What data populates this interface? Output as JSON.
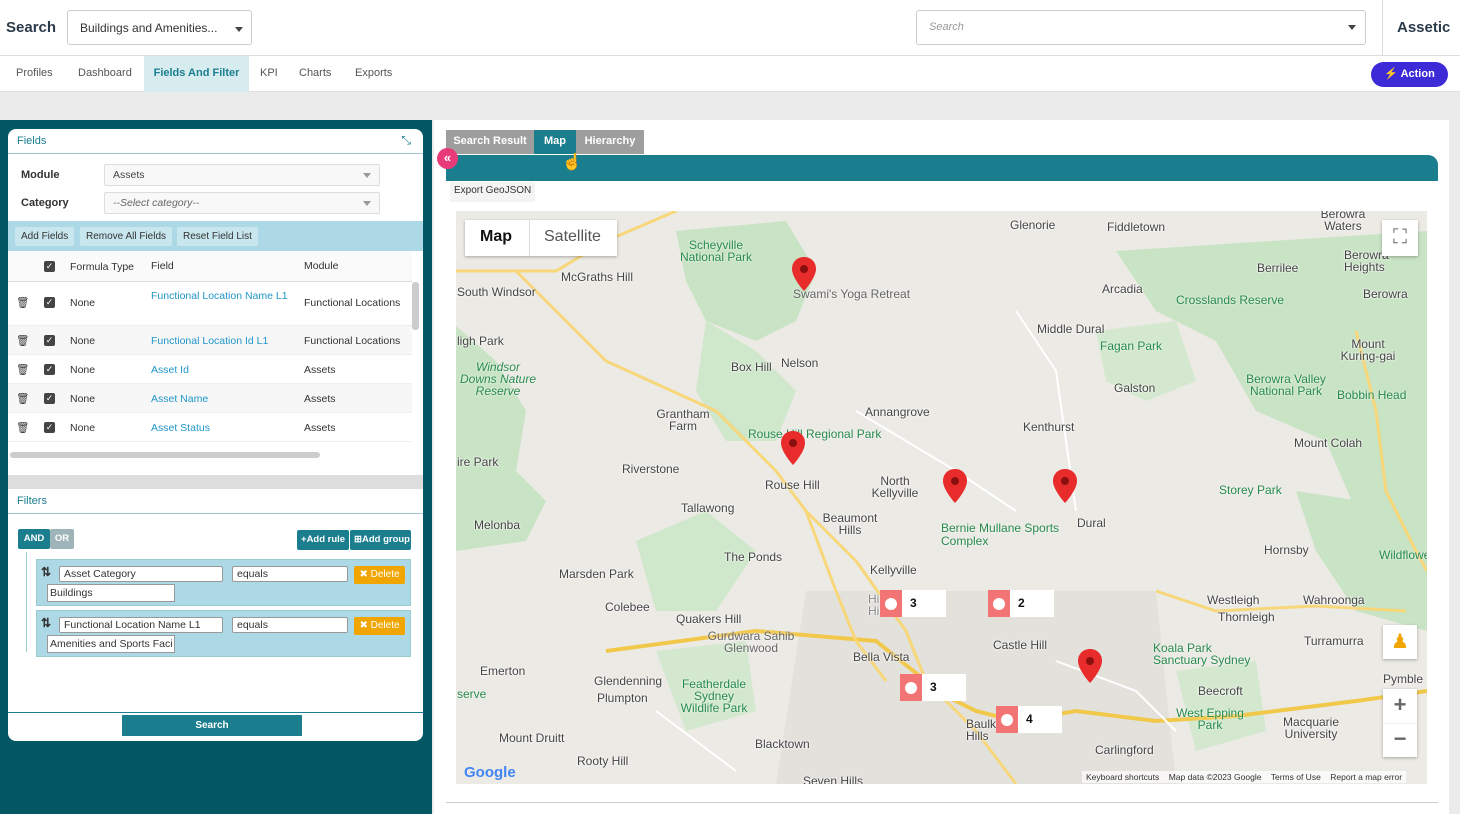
{
  "topbar": {
    "title": "Search",
    "profile_value": "Buildings and Amenities...",
    "search_placeholder": "Search",
    "brand": "Assetic"
  },
  "nav": {
    "tabs": [
      "Profiles",
      "Dashboard",
      "Fields And Filter",
      "KPI",
      "Charts",
      "Exports"
    ],
    "active": "Fields And Filter",
    "action_label": "Action"
  },
  "fields": {
    "title": "Fields",
    "module_label": "Module",
    "module_value": "Assets",
    "category_label": "Category",
    "category_value": "--Select category--",
    "buttons": [
      "Add Fields",
      "Remove All Fields",
      "Reset Field List"
    ],
    "columns": [
      "Formula Type",
      "Field",
      "Module"
    ],
    "rows": [
      {
        "formula": "None",
        "field": "Functional Location Name L1",
        "module": "Functional Locations"
      },
      {
        "formula": "None",
        "field": "Functional Location Id L1",
        "module": "Functional Locations"
      },
      {
        "formula": "None",
        "field": "Asset Id",
        "module": "Assets"
      },
      {
        "formula": "None",
        "field": "Asset Name",
        "module": "Assets"
      },
      {
        "formula": "None",
        "field": "Asset Status",
        "module": "Assets"
      }
    ]
  },
  "filters": {
    "title": "Filters",
    "and_label": "AND",
    "or_label": "OR",
    "add_rule": "Add rule",
    "add_group": "Add group",
    "delete_label": "Delete",
    "rules": [
      {
        "field": "Asset Category",
        "operator": "equals",
        "value": "Buildings"
      },
      {
        "field": "Functional Location Name L1",
        "operator": "equals",
        "value": "Amenities and Sports Faci"
      }
    ],
    "search_label": "Search"
  },
  "results": {
    "tabs": [
      "Search Result",
      "Map",
      "Hierarchy"
    ],
    "active_tab": "Map",
    "export_label": "Export GeoJSON"
  },
  "map": {
    "mode_map": "Map",
    "mode_satellite": "Satellite",
    "clusters": [
      "3",
      "2",
      "3",
      "4"
    ],
    "attribution": [
      "Keyboard shortcuts",
      "Map data ©2023 Google",
      "Terms of Use",
      "Report a map error"
    ],
    "logo": "Google",
    "places": [
      "Glenorie",
      "Fiddletown",
      "Berowra Waters",
      "Berowra Heights",
      "Berrilee",
      "Berowra",
      "Arcadia",
      "Scheyville National Park",
      "McGraths Hill",
      "South Windsor",
      "Swami's Yoga Retreat",
      "Crosslands Reserve",
      "Middle Dural",
      "Fagan Park",
      "Mount Kuring-gai",
      "Box Hill",
      "Nelson",
      "Galston",
      "Berowra Valley National Park",
      "Bobbin Head",
      "Windsor Downs Nature Reserve",
      "Annangrove",
      "Kenthurst",
      "Grantham Farm",
      "Rouse Hill Regional Park",
      "Mount Colah",
      "Riverstone",
      "Rouse Hill",
      "North Kellyville",
      "Dural",
      "Storey Park",
      "Tallawong",
      "Melonba",
      "Beaumont Hills",
      "Bernie Mullane Sports Complex",
      "Hornsby",
      "The Ponds",
      "Kellyville",
      "Wildflower",
      "Marsden Park",
      "Colebee",
      "Westleigh",
      "Wahroonga",
      "Thornleigh",
      "Quakers Hill",
      "Gurdwara Sahib Glenwood",
      "Bella Vista",
      "Castle Hill",
      "Turramurra",
      "Koala Park Sanctuary Sydney",
      "Emerton",
      "Glendenning",
      "Plumpton",
      "Featherdale Sydney Wildlife Park",
      "Pymble",
      "Beecroft",
      "West Epping Park",
      "Macquarie University",
      "Mount Druitt",
      "Blacktown",
      "Baulkham Hills",
      "Carlingford",
      "Rooty Hill",
      "Seven Hills",
      "Hillsong Hills",
      "ligh Park",
      "ire Park",
      "serve"
    ]
  }
}
